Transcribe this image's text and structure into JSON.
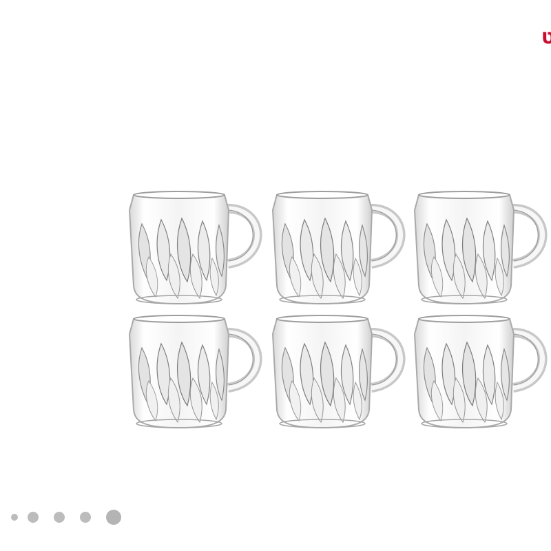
{
  "brand": {
    "glyph": "ט",
    "color": "#c8102e"
  },
  "product_image": {
    "description_icon": "glass-mug-set-image",
    "mug_count": 6,
    "rows": 2,
    "columns": 3
  },
  "carousel": {
    "total_slides": 5,
    "active_index": 4,
    "dot_color": "#bcbcbc"
  }
}
